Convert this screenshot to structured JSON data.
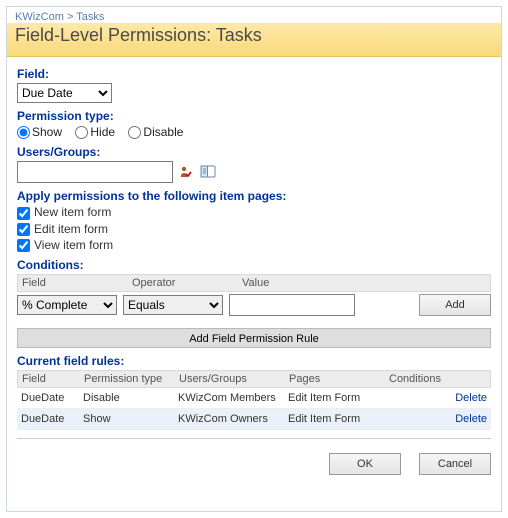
{
  "breadcrumb": {
    "root": "KWizCom",
    "sep": ">",
    "leaf": "Tasks"
  },
  "title": "Field-Level Permissions: Tasks",
  "labels": {
    "field": "Field:",
    "permission_type": "Permission type:",
    "users_groups": "Users/Groups:",
    "apply_header": "Apply permissions to the following item pages:",
    "conditions": "Conditions:",
    "current_rules": "Current field rules:"
  },
  "field_select": {
    "value": "Due Date"
  },
  "perm_radios": {
    "show": "Show",
    "hide": "Hide",
    "disable": "Disable",
    "selected": "show"
  },
  "users_groups_input": {
    "value": ""
  },
  "icons": {
    "validate": "validate-user-icon",
    "browse": "browse-directory-icon"
  },
  "apply_pages": {
    "new": {
      "label": "New item form",
      "checked": true
    },
    "edit": {
      "label": "Edit item form",
      "checked": true
    },
    "view": {
      "label": "View item form",
      "checked": true
    }
  },
  "conditions_cols": {
    "field": "Field",
    "operator": "Operator",
    "value": "Value"
  },
  "condition_row": {
    "field": "% Complete",
    "operator": "Equals",
    "value": ""
  },
  "buttons": {
    "add": "Add",
    "add_rule": "Add Field Permission Rule",
    "ok": "OK",
    "cancel": "Cancel",
    "delete": "Delete"
  },
  "rules_cols": {
    "field": "Field",
    "perm": "Permission type",
    "ug": "Users/Groups",
    "pages": "Pages",
    "cond": "Conditions"
  },
  "rules": [
    {
      "field": "DueDate",
      "perm": "Disable",
      "ug": "KWizCom Members",
      "pages": "Edit Item Form",
      "cond": ""
    },
    {
      "field": "DueDate",
      "perm": "Show",
      "ug": "KWizCom Owners",
      "pages": "Edit Item Form",
      "cond": ""
    }
  ]
}
